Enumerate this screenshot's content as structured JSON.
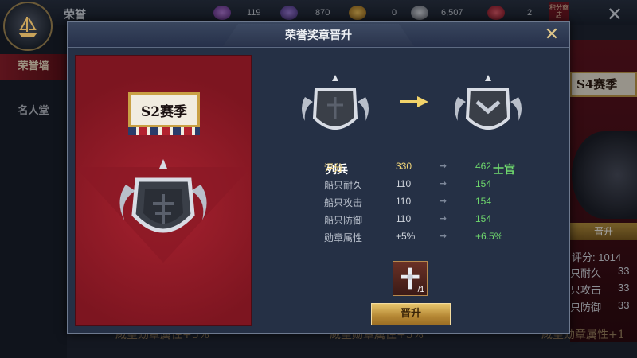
{
  "topbar": {
    "title": "荣誉",
    "resources": [
      {
        "icon": "purple-feather-icon",
        "value": "119"
      },
      {
        "icon": "purple-token-icon",
        "value": "870"
      },
      {
        "icon": "gold-coin-icon",
        "value": "0"
      },
      {
        "icon": "silver-coin-icon",
        "value": "6,507"
      },
      {
        "icon": "red-ticket-icon",
        "value": "2"
      }
    ],
    "rank_shop_label": "积分商店"
  },
  "sidebar": {
    "items": [
      {
        "label": "荣誉墙",
        "active": true
      },
      {
        "label": "名人堂",
        "active": false
      }
    ]
  },
  "background": {
    "season_label": "S4赛季",
    "promote_label": "晋升",
    "stats": [
      "评分: 1014",
      "只耐久",
      "只攻击",
      "只防御"
    ],
    "partial_values": [
      "33",
      "33",
      "33"
    ],
    "bottom_texts": [
      "威望勋章属性+5%",
      "威望勋章属性+5%",
      "威望勋章属性+1"
    ]
  },
  "dialog": {
    "title": "荣誉奖章晋升",
    "season_label": "S2赛季",
    "from_rank": "列兵",
    "to_rank": "士官",
    "stats": [
      {
        "name": "评分",
        "from": "330",
        "to": "462"
      },
      {
        "name": "船只耐久",
        "from": "110",
        "to": "154"
      },
      {
        "name": "船只攻击",
        "from": "110",
        "to": "154"
      },
      {
        "name": "船只防御",
        "from": "110",
        "to": "154"
      },
      {
        "name": "勋章属性",
        "from": "+5%",
        "to": "+6.5%"
      }
    ],
    "item_count": "/1",
    "promote_button": "晋升"
  },
  "colors": {
    "accent_green": "#6fd96d",
    "accent_gold": "#f3d77a",
    "card_red": "#a6212f",
    "dialog_bg": "#253045"
  }
}
